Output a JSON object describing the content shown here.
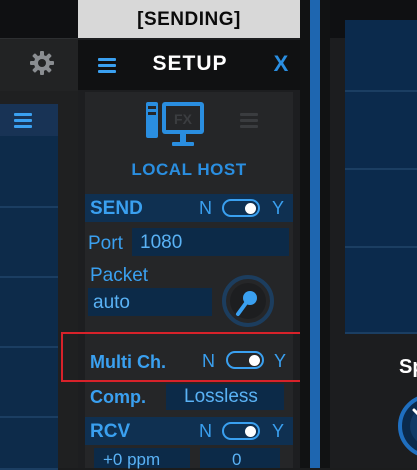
{
  "center": {
    "title": "[SENDING]"
  },
  "setup": {
    "title": "SETUP",
    "close": "X",
    "host_label": "LOCAL HOST",
    "icon_badge": "FX"
  },
  "send": {
    "label": "SEND",
    "n": "N",
    "y": "Y",
    "toggle_on": true,
    "port_label": "Port",
    "port_value": "1080",
    "packet_label": "Packet",
    "packet_value": "auto"
  },
  "multi": {
    "label": "Multi Ch.",
    "n": "N",
    "y": "Y",
    "toggle_on": true
  },
  "comp": {
    "label": "Comp.",
    "value": "Lossless"
  },
  "rcv": {
    "label": "RCV",
    "n": "N",
    "y": "Y",
    "toggle_on": true,
    "ppm_value": "+0 ppm",
    "offset_value": "0"
  },
  "right": {
    "partial_label": "Sp"
  },
  "colors": {
    "accent": "#3aa0f0",
    "highlight": "#d8222a"
  }
}
